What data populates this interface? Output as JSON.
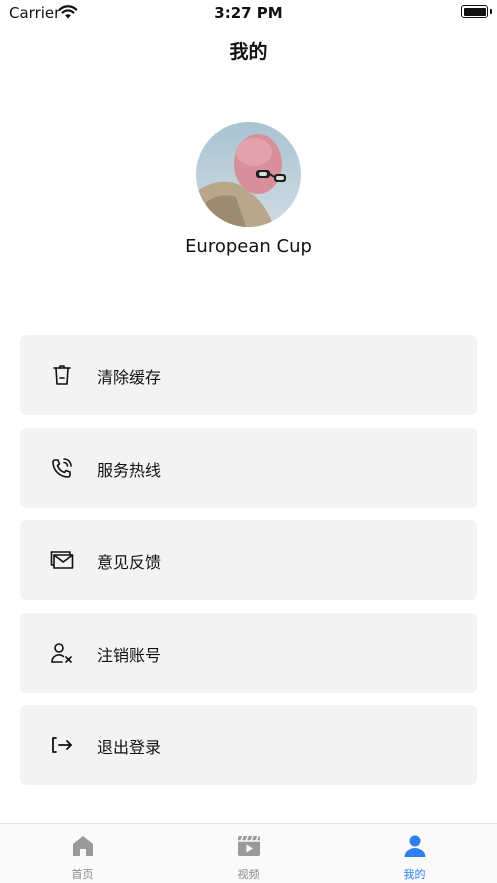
{
  "status_bar": {
    "carrier": "Carrier",
    "time": "3:27 PM"
  },
  "header": {
    "title": "我的"
  },
  "profile": {
    "name": "European Cup"
  },
  "menu": [
    {
      "label": "清除缓存",
      "icon": "trash-icon"
    },
    {
      "label": "服务热线",
      "icon": "phone-call-icon"
    },
    {
      "label": "意见反馈",
      "icon": "mail-icon"
    },
    {
      "label": "注销账号",
      "icon": "user-remove-icon"
    },
    {
      "label": "退出登录",
      "icon": "logout-icon"
    }
  ],
  "tabs": [
    {
      "label": "首页",
      "icon": "home-icon",
      "active": false
    },
    {
      "label": "视频",
      "icon": "video-icon",
      "active": false
    },
    {
      "label": "我的",
      "icon": "profile-icon",
      "active": true
    }
  ],
  "colors": {
    "accent": "#2f80ed",
    "card_bg": "#f3f3f3",
    "inactive": "#8a8a8a"
  }
}
